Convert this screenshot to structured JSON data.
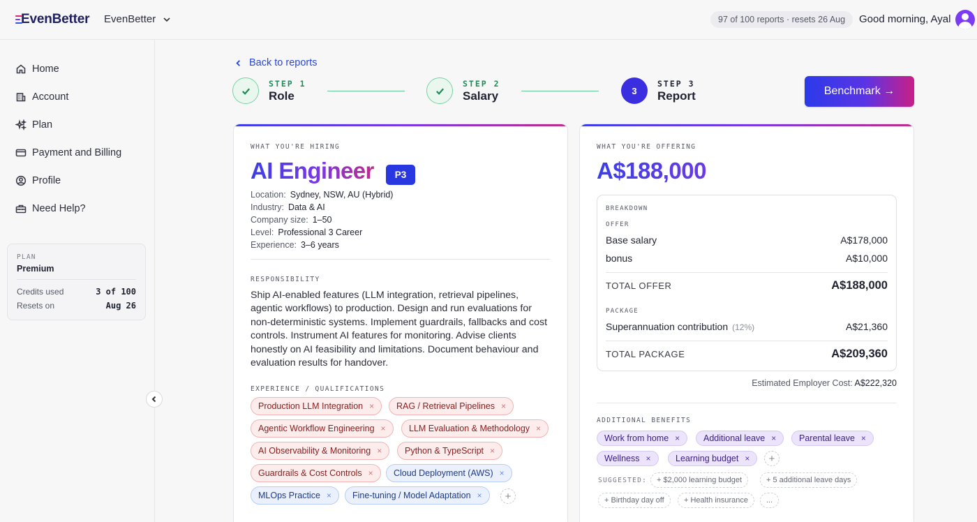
{
  "topbar": {
    "logo_text": "EvenBetter",
    "org_name": "EvenBetter",
    "credits_pill": "97 of 100 reports · resets 26 Aug",
    "greeting": "Good morning, Ayal"
  },
  "sidebar": {
    "items": [
      {
        "label": "Home",
        "icon": "home-icon"
      },
      {
        "label": "Account",
        "icon": "building-icon"
      },
      {
        "label": "Plan",
        "icon": "sparkles-icon"
      },
      {
        "label": "Payment and Billing",
        "icon": "credit-card-icon"
      },
      {
        "label": "Profile",
        "icon": "user-circle-icon"
      },
      {
        "label": "Need Help?",
        "icon": "toolbox-icon"
      }
    ],
    "plan": {
      "label": "PLAN",
      "name": "Premium",
      "credits_label": "Credits used",
      "credits_value": "3 of 100",
      "resets_label": "Resets on",
      "resets_value": "Aug 26"
    }
  },
  "main": {
    "back_label": "Back to reports",
    "steps": [
      {
        "kicker": "STEP 1",
        "title": "Role",
        "state": "done"
      },
      {
        "kicker": "STEP 2",
        "title": "Salary",
        "state": "done"
      },
      {
        "kicker": "STEP 3",
        "title": "Report",
        "state": "active",
        "number": "3"
      }
    ],
    "benchmark_label": "Benchmark →",
    "hiring": {
      "kicker": "WHAT YOU'RE HIRING",
      "role": "AI Engineer",
      "level_badge": "P3",
      "details": [
        {
          "key": "Location:",
          "value": "Sydney, NSW, AU (Hybrid)"
        },
        {
          "key": "Industry:",
          "value": "Data & AI"
        },
        {
          "key": "Company size:",
          "value": "1–50"
        },
        {
          "key": "Level:",
          "value": "Professional 3 Career"
        },
        {
          "key": "Experience:",
          "value": "3–6 years"
        }
      ],
      "responsibility_kicker": "RESPONSIBILITY",
      "responsibility_text": "Ship AI-enabled features (LLM integration, retrieval pipelines, agentic workflows) to production. Design and run evaluations for non-deterministic systems. Implement guardrails, fallbacks and cost controls. Instrument AI features for monitoring. Advise clients honestly on AI feasibility and limitations. Document behaviour and evaluation results for handover.",
      "qualifications_kicker": "EXPERIENCE / QUALIFICATIONS",
      "skills": [
        {
          "label": "Production LLM Integration",
          "tone": "red"
        },
        {
          "label": "RAG / Retrieval Pipelines",
          "tone": "red"
        },
        {
          "label": "Agentic Workflow Engineering",
          "tone": "red"
        },
        {
          "label": "LLM Evaluation & Methodology",
          "tone": "red"
        },
        {
          "label": "AI Observability & Monitoring",
          "tone": "red"
        },
        {
          "label": "Python & TypeScript",
          "tone": "red"
        },
        {
          "label": "Guardrails & Cost Controls",
          "tone": "red"
        },
        {
          "label": "Cloud Deployment (AWS)",
          "tone": "blue"
        },
        {
          "label": "MLOps Practice",
          "tone": "blue"
        },
        {
          "label": "Fine-tuning / Model Adaptation",
          "tone": "blue"
        }
      ],
      "remove_glyph": "×",
      "add_glyph": "+"
    },
    "offering": {
      "kicker": "WHAT YOU'RE OFFERING",
      "total": "A$188,000",
      "breakdown_kicker": "BREAKDOWN",
      "offer_kicker": "OFFER",
      "base_label": "Base salary",
      "base_value": "A$178,000",
      "bonus_label": "bonus",
      "bonus_value": "A$10,000",
      "total_offer_label": "TOTAL OFFER",
      "total_offer_value": "A$188,000",
      "package_kicker": "PACKAGE",
      "super_label": "Superannuation contribution",
      "super_pct": "(12%)",
      "super_value": "A$21,360",
      "total_package_label": "TOTAL PACKAGE",
      "total_package_value": "A$209,360",
      "employer_cost_label": "Estimated Employer Cost:",
      "employer_cost_value": "A$222,320",
      "benefits_kicker": "ADDITIONAL BENEFITS",
      "benefits": [
        "Work from home",
        "Additional leave",
        "Parental leave",
        "Wellness",
        "Learning budget"
      ],
      "suggested_label": "SUGGESTED:",
      "suggestions": [
        "+ $2,000 learning budget",
        "+ 5 additional leave days",
        "+ Birthday day off",
        "+ Health insurance",
        "..."
      ]
    }
  },
  "colors": {
    "accent": "#3b2ee0",
    "success": "#1f8c57",
    "skill_red_bg": "#fdecec",
    "skill_blue_bg": "#eaf1fd",
    "benefit_purple_bg": "#ebe4fb"
  }
}
